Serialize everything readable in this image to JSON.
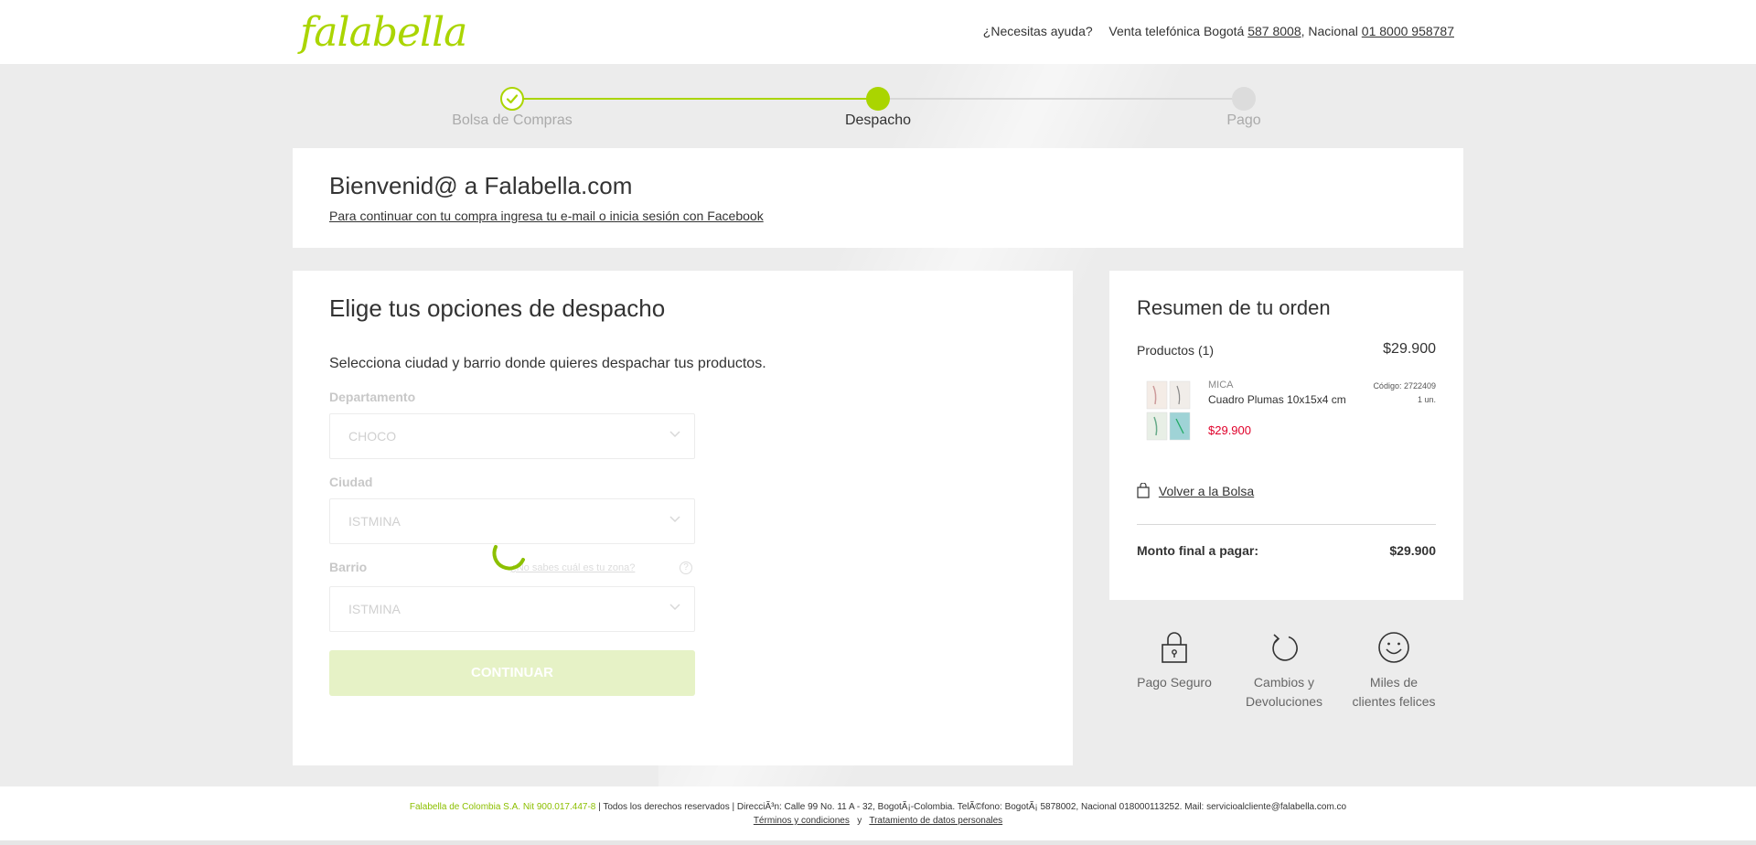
{
  "header": {
    "logo": "falabella",
    "help_text": "¿Necesitas ayuda?",
    "phone_prefix": "Venta telefónica Bogotá",
    "bogota_phone": "587 8008",
    "national_prefix": ", Nacional",
    "national_phone": "01 8000 958787"
  },
  "stepper": {
    "steps": [
      {
        "label": "Bolsa de Compras",
        "state": "done"
      },
      {
        "label": "Despacho",
        "state": "active"
      },
      {
        "label": "Pago",
        "state": "pending"
      }
    ],
    "active_color": "#aad500"
  },
  "welcome": {
    "title": "Bienvenid@ a Falabella.com",
    "link": "Para continuar con tu compra ingresa tu e-mail o inicia sesión con Facebook"
  },
  "shipping": {
    "title": "Elige tus opciones de despacho",
    "description": "Selecciona ciudad y barrio donde quieres despachar tus productos.",
    "department_label": "Departamento",
    "department_value": "CHOCO",
    "city_label": "Ciudad",
    "city_value": "ISTMINA",
    "barrio_label": "Barrio",
    "barrio_value": "ISTMINA",
    "zone_help": "¿No sabes cuál es tu zona?",
    "zone_help_icon": "?",
    "continue_label": "CONTINUAR"
  },
  "summary": {
    "title": "Resumen de tu orden",
    "products_label": "Productos",
    "products_count": "(1)",
    "products_total": "$29.900",
    "item": {
      "brand": "MICA",
      "name": "Cuadro Plumas 10x15x4 cm",
      "price": "$29.900",
      "code": "Código: 2722409",
      "qty": "1 un."
    },
    "back_to_bag": "Volver a la Bolsa",
    "total_label": "Monto final a pagar:",
    "total_value": "$29.900"
  },
  "badges": [
    {
      "icon": "lock-icon",
      "line1": "Pago Seguro",
      "line2": ""
    },
    {
      "icon": "refresh-icon",
      "line1": "Cambios y",
      "line2": "Devoluciones"
    },
    {
      "icon": "smile-icon",
      "line1": "Miles de",
      "line2": "clientes felices"
    }
  ],
  "footer": {
    "company": "Falabella de Colombia S.A. Nit 900.017.447-8",
    "rights": "|  Todos los derechos reservados  |  DirecciÃ³n: Calle 99 No. 11 A - 32, BogotÃ¡-Colombia. TelÃ©fono: BogotÃ¡ 5878002, Nacional 018000113252. Mail: servicioalcliente@falabella.com.co",
    "terms": "Términos y condiciones",
    "and": "y",
    "privacy": "Tratamiento de datos personales"
  }
}
